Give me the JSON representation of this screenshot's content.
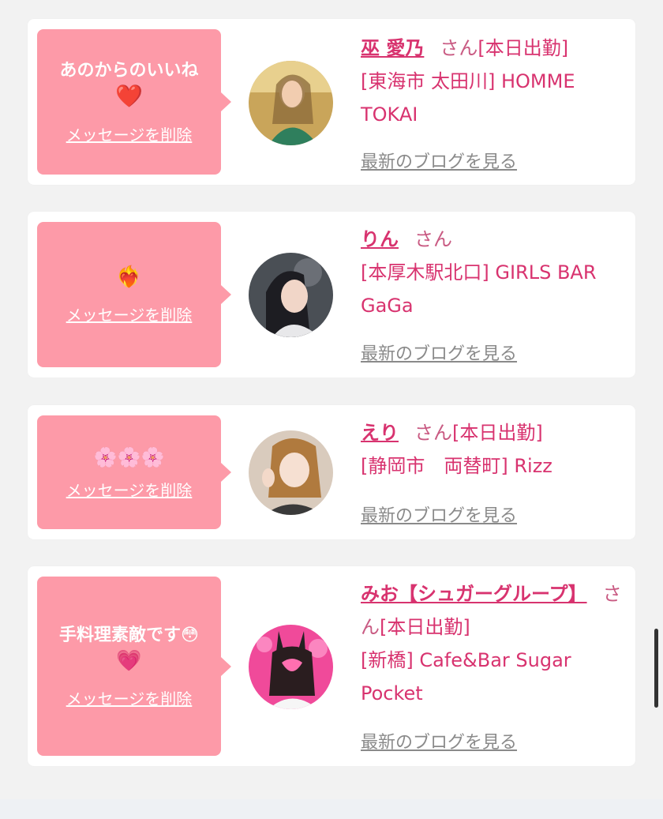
{
  "cards": [
    {
      "message": "あのからのいいね",
      "message_emoji": "❤️",
      "delete_label": "メッセージを削除",
      "name": "巫 愛乃",
      "honorific": "さん",
      "status": "[本日出勤]",
      "location": "[東海市 太田川] HOMME TOKAI",
      "blog_label": "最新のブログを見る"
    },
    {
      "message": "",
      "message_emoji": "❤️‍🔥",
      "delete_label": "メッセージを削除",
      "name": "りん",
      "honorific": "さん",
      "status": "",
      "location": "[本厚木駅北口] GIRLS BAR GaGa",
      "blog_label": "最新のブログを見る"
    },
    {
      "message": "",
      "message_emoji": "🌸🌸🌸",
      "delete_label": "メッセージを削除",
      "name": "えり",
      "honorific": "さん",
      "status": "[本日出勤]",
      "location": "[静岡市　両替町] Rizz",
      "blog_label": "最新のブログを見る"
    },
    {
      "message": "手料理素敵です😳",
      "message_emoji": "💗",
      "delete_label": "メッセージを削除",
      "name": "みお【シュガーグループ】",
      "honorific": "さん",
      "status": "[本日出勤]",
      "location": "[新橋] Cafe&Bar Sugar Pocket",
      "blog_label": "最新のブログを見る"
    }
  ],
  "colors": {
    "bubble": "#fd9aa8",
    "name": "#d8336f",
    "link_gray": "#8a8a8a",
    "background": "#f2f2f2"
  }
}
